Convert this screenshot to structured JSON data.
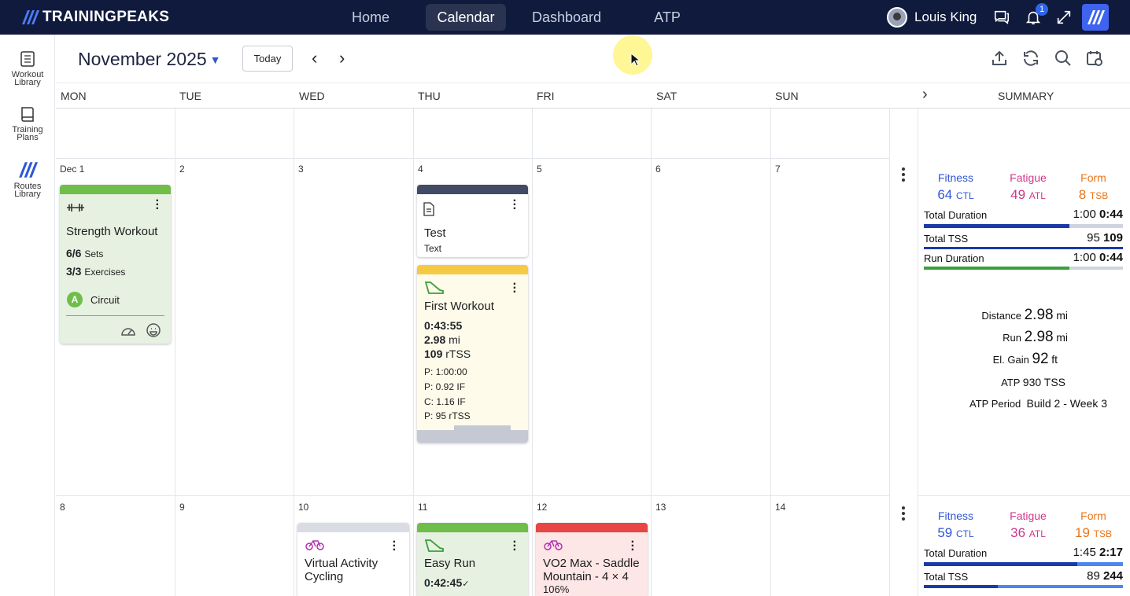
{
  "app": {
    "brand": "TRAININGPEAKS"
  },
  "nav": [
    {
      "label": "Home"
    },
    {
      "label": "Calendar"
    },
    {
      "label": "Dashboard"
    },
    {
      "label": "ATP"
    }
  ],
  "user": {
    "name": "Louis King",
    "notifications": "1"
  },
  "sidebar": [
    {
      "label": "Workout Library",
      "icon": "book-list-icon"
    },
    {
      "label": "Training Plans",
      "icon": "book-icon"
    },
    {
      "label": "Routes Library",
      "icon": "routes-icon"
    }
  ],
  "header": {
    "month": "November 2025",
    "today_label": "Today"
  },
  "days": [
    "MON",
    "TUE",
    "WED",
    "THU",
    "FRI",
    "SAT",
    "SUN"
  ],
  "summary_label": "SUMMARY",
  "week1": {
    "daynums": [
      "Dec 1",
      "2",
      "3",
      "4",
      "5",
      "6",
      "7"
    ],
    "strength": {
      "title": "Strength Workout",
      "sets_v": "6/6",
      "sets_l": "Sets",
      "ex_v": "3/3",
      "ex_l": "Exercises",
      "circuit_letter": "A",
      "circuit": "Circuit"
    },
    "note": {
      "title": "Test",
      "sub": "Text"
    },
    "first": {
      "title": "First Workout",
      "dur": "0:43:55",
      "dist_v": "2.98",
      "dist_u": "mi",
      "tss_v": "109",
      "tss_u": "rTSS",
      "p1": "P: 1:00:00",
      "p2": "P: 0.92 IF",
      "p3": "C: 1.16 IF",
      "p4": "P: 95 rTSS"
    },
    "summary": {
      "fitness_l": "Fitness",
      "fitness_v": "64",
      "fitness_u": "CTL",
      "fatigue_l": "Fatigue",
      "fatigue_v": "49",
      "fatigue_u": "ATL",
      "form_l": "Form",
      "form_v": "8",
      "form_u": "TSB",
      "rows": [
        {
          "label": "Total Duration",
          "planned": "1:00",
          "done": "0:44",
          "fill": 0.73
        },
        {
          "label": "Total TSS",
          "planned": "95",
          "done": "109",
          "fill": 1.0
        },
        {
          "label": "Run Duration",
          "planned": "1:00",
          "done": "0:44",
          "fill": 0.73
        }
      ],
      "stats": [
        {
          "label": "Distance",
          "value": "2.98",
          "unit": "mi"
        },
        {
          "label": "Run",
          "value": "2.98",
          "unit": "mi"
        },
        {
          "label": "El. Gain",
          "value": "92",
          "unit": "ft"
        },
        {
          "label": "ATP",
          "value": "930",
          "unit": "TSS"
        },
        {
          "label": "ATP Period",
          "value": "Build 2 - Week 3",
          "unit": ""
        }
      ]
    }
  },
  "week2": {
    "daynums": [
      "8",
      "9",
      "10",
      "11",
      "12",
      "13",
      "14"
    ],
    "virtual": {
      "title": "Virtual Activity Cycling"
    },
    "easy": {
      "title": "Easy Run",
      "dur": "0:42:45"
    },
    "vo2": {
      "title": "VO2 Max - Saddle Mountain - 4 × 4",
      "extra": "106%"
    },
    "summary": {
      "fitness_l": "Fitness",
      "fitness_v": "59",
      "fitness_u": "CTL",
      "fatigue_l": "Fatigue",
      "fatigue_v": "36",
      "fatigue_u": "ATL",
      "form_l": "Form",
      "form_v": "19",
      "form_u": "TSB",
      "rows": [
        {
          "label": "Total Duration",
          "planned": "1:45",
          "done": "2:17",
          "fill": 0.77
        },
        {
          "label": "Total TSS",
          "planned": "89",
          "done": "244",
          "fill": 0.37
        }
      ]
    }
  },
  "colors": {
    "topbar": "#0f1a3d",
    "fitness": "#2f56d6",
    "fatigue": "#d0378d",
    "form": "#e8751a",
    "strength_bar": "#6fbe4a",
    "run_bar": "#f6c945",
    "note_bar": "#414b66",
    "vo2_bar": "#e84545"
  }
}
